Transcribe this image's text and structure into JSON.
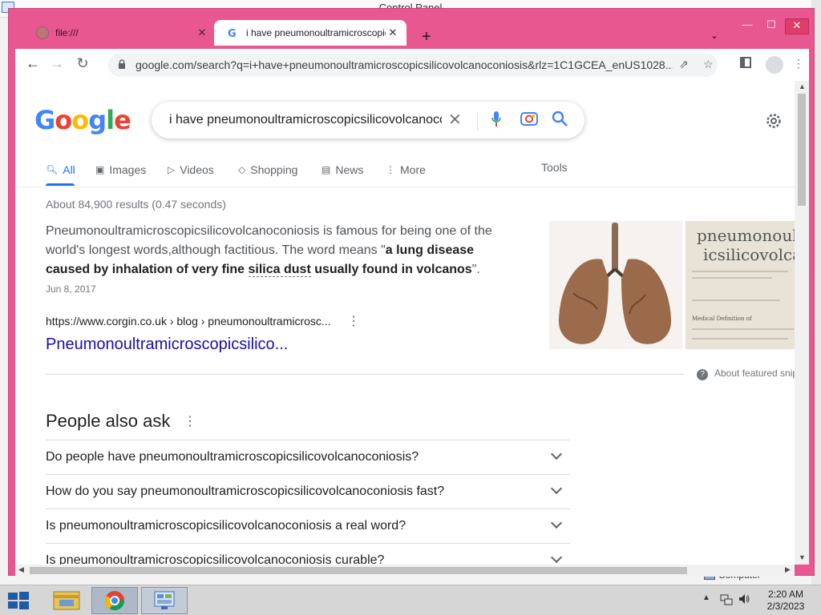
{
  "background_window": {
    "title": "Control Panel",
    "computer_label": "Computer"
  },
  "browser": {
    "tabs": [
      {
        "title": "file:///",
        "active": false
      },
      {
        "title": "i have pneumonoultramicroscopicsilicovolcanoconiosis - Google Search",
        "active": true
      }
    ],
    "new_tab": "+",
    "url": "google.com/search?q=i+have+pneumonoultramicroscopicsilicovolcanoconiosis&rlz=1C1GCEA_enUS1028..."
  },
  "google": {
    "logo_letters": [
      {
        "ch": "G",
        "color": "#4285F4"
      },
      {
        "ch": "o",
        "color": "#EA4335"
      },
      {
        "ch": "o",
        "color": "#FBBC05"
      },
      {
        "ch": "g",
        "color": "#4285F4"
      },
      {
        "ch": "l",
        "color": "#34A853"
      },
      {
        "ch": "e",
        "color": "#EA4335"
      }
    ],
    "query": "i have pneumonoultramicroscopicsilicovolcanoconiosis",
    "nav": {
      "all": "All",
      "images": "Images",
      "videos": "Videos",
      "shopping": "Shopping",
      "news": "News",
      "more": "More",
      "tools": "Tools"
    },
    "results_count": "About 84,900 results (0.47 seconds)",
    "snippet": {
      "text_part1": "Pneumonoultramicroscopicsilicovolcanoconiosis is famous for being one of the world's longest words,although factitious. The word means \"",
      "bold_part1": "a lung disease caused by inhalation of very fine ",
      "bold_dotted": "silica dust",
      "bold_part2": " usually found in volcanos",
      "text_part2": "\".",
      "date": "Jun 8, 2017"
    },
    "source": {
      "url": "https://www.corgin.co.uk › blog › pneumonoultramicrosc...",
      "title": "Pneumonoultramicroscopicsilico..."
    },
    "featured_image2_text": [
      "pneumonoultra",
      "icsilicovolcano",
      "Medical Definition of"
    ],
    "about_featured": "About featured snippets",
    "people_also_ask": {
      "title": "People also ask",
      "questions": [
        "Do people have pneumonoultramicroscopicsilicovolcanoconiosis?",
        "How do you say pneumonoultramicroscopicsilicovolcanoconiosis fast?",
        "Is pneumonoultramicroscopicsilicovolcanoconiosis a real word?",
        "Is pneumonoultramicroscopicsilicovolcanoconiosis curable?"
      ]
    }
  },
  "taskbar": {
    "time": "2:20 AM",
    "date": "2/3/2023"
  },
  "colors": {
    "browser_frame": "#e8578f",
    "link": "#1a0dab",
    "accent": "#1a73e8"
  }
}
